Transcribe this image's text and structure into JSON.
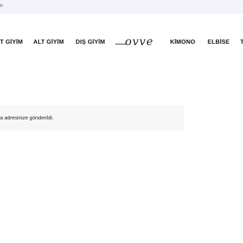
{
  "topbar": {
    "text": "n"
  },
  "nav": {
    "items": [
      {
        "label": "T GİYİM"
      },
      {
        "label": "ALT GİYİM"
      },
      {
        "label": "DIŞ GİYİM"
      },
      {
        "label": "KİMONO"
      },
      {
        "label": "ELBİSE"
      }
    ],
    "logo_text": "ovve",
    "partial_item": "T"
  },
  "notice": {
    "text": "a adresinize gönderildi."
  }
}
